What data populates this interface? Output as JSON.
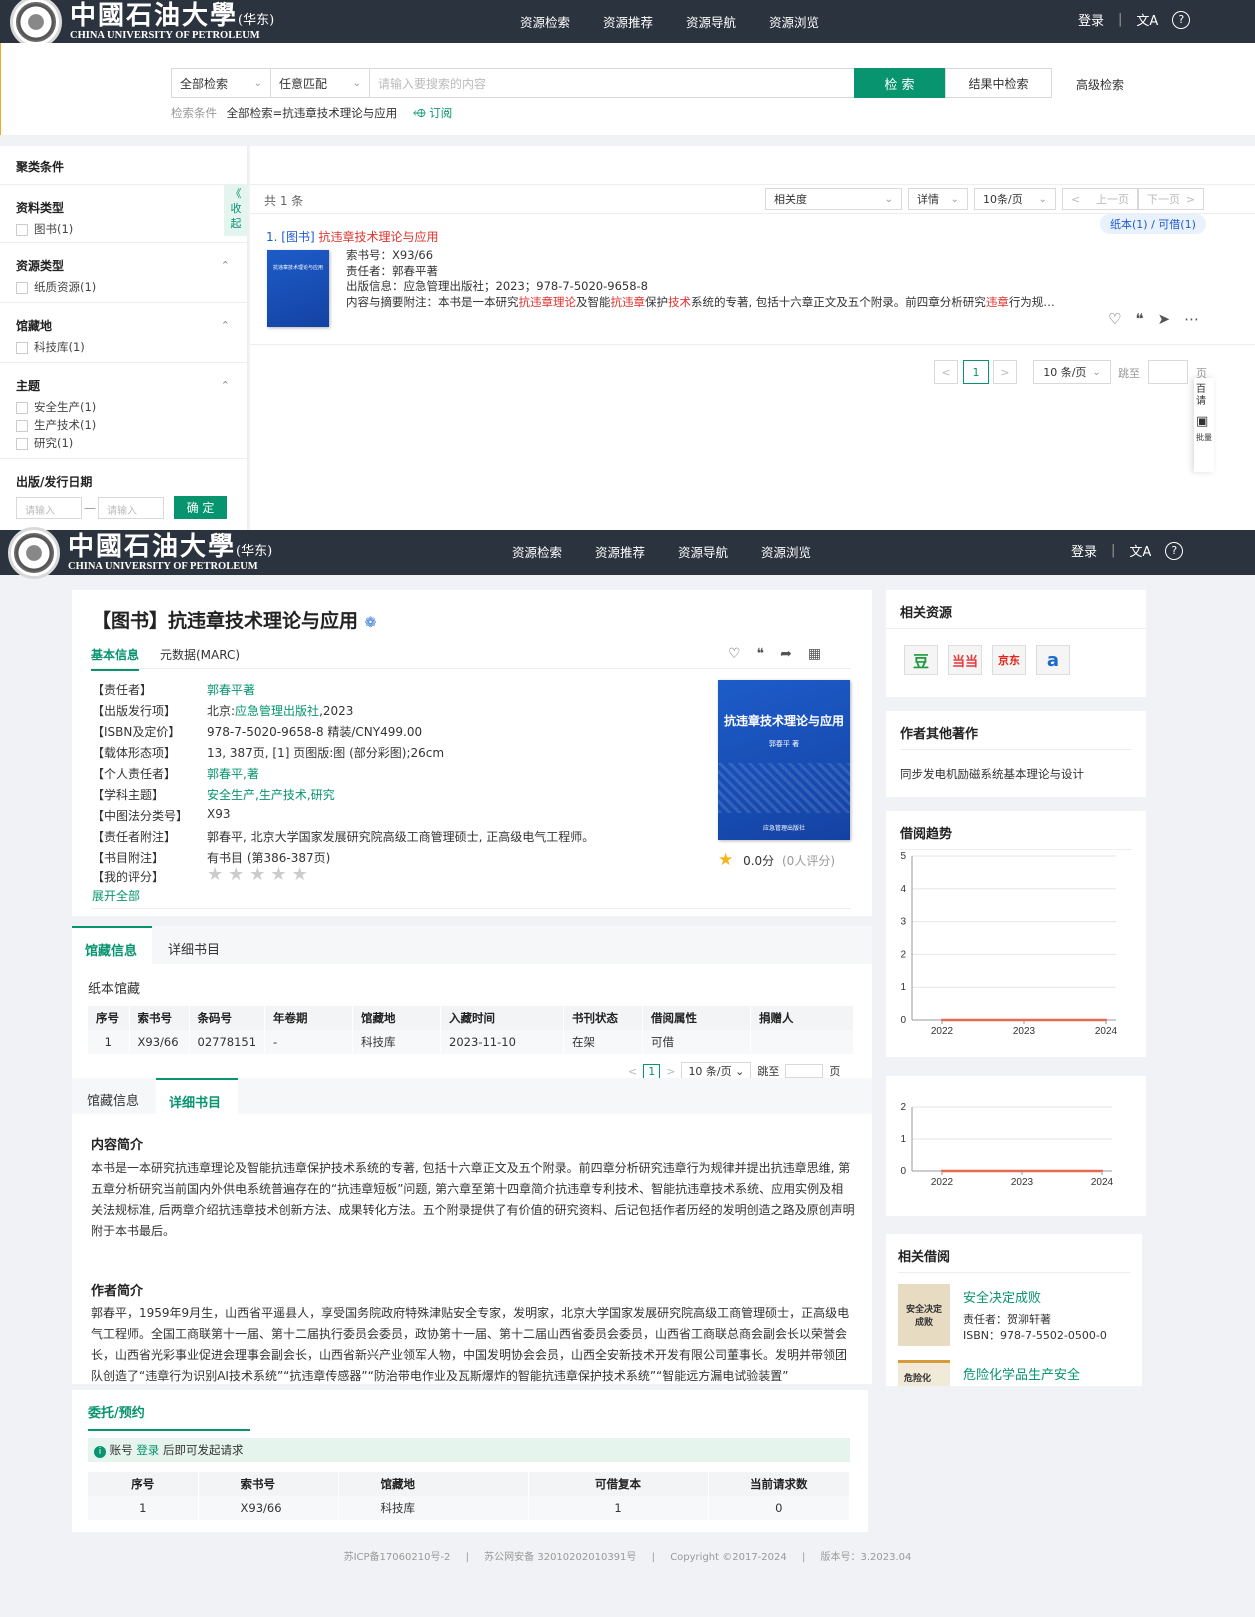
{
  "header": {
    "logo_cn": "中國石油大學",
    "logo_suffix": "(华东)",
    "logo_en": "CHINA UNIVERSITY OF PETROLEUM",
    "nav": [
      "资源检索",
      "资源推荐",
      "资源导航",
      "资源浏览"
    ],
    "login": "登录",
    "separator": "|",
    "translate_icon": "文A",
    "help_icon": "?"
  },
  "search": {
    "scope": "全部检索",
    "match": "任意匹配",
    "placeholder": "请输入要搜索的内容",
    "search_btn": "检 索",
    "in_results_btn": "结果中检索",
    "advanced": "高级检索",
    "cond_label": "检索条件",
    "cond_value": "全部检索=抗违章技术理论与应用",
    "subscribe": "订阅"
  },
  "facets": {
    "title": "聚类条件",
    "collapse": "《 收 起",
    "groups": [
      {
        "title": "资料类型",
        "items": [
          "图书(1)"
        ]
      },
      {
        "title": "资源类型",
        "items": [
          "纸质资源(1)"
        ]
      },
      {
        "title": "馆藏地",
        "items": [
          "科技库(1)"
        ]
      },
      {
        "title": "主题",
        "items": [
          "安全生产(1)",
          "生产技术(1)",
          "研究(1)"
        ]
      }
    ],
    "date_title": "出版/发行日期",
    "date_ph1": "请输入",
    "date_ph2": "请输入",
    "date_sep": "—",
    "confirm": "确 定"
  },
  "results": {
    "count": "共 1 条",
    "sort": "相关度",
    "view": "详情",
    "per_page": "10条/页",
    "prev": "上一页",
    "next": "下一页",
    "availability": "纸本(1) / 可借(1)",
    "item": {
      "index": "1.",
      "type": "[图书]",
      "title": "抗违章技术理论与应用",
      "callno": "索书号：X93/66",
      "author": "责任者：郭春平著",
      "pub": "出版信息：应急管理出版社；2023；978-7-5020-9658-8",
      "abstract_pre": "内容与摘要附注：本书是一本研究",
      "hl1": "抗违章理论",
      "mid1": "及智能",
      "hl2": "抗违章",
      "mid2": "保护",
      "hl3": "技术",
      "mid3": "系统的专著, 包括十六章正文及五个附录。前四章分析研究",
      "hl4": "违章",
      "tail": "行为规…"
    },
    "pager": {
      "prev": "<",
      "page": "1",
      "next": ">",
      "size": "10 条/页",
      "jump": "跳至",
      "page_unit": "页"
    }
  },
  "float_panel": {
    "t1": "百",
    "t2": "请",
    "t3": "批量"
  },
  "detail": {
    "title": "【图书】抗违章技术理论与应用",
    "tabs": [
      "基本信息",
      "元数据(MARC)"
    ],
    "fields": [
      {
        "k": "【责任者】",
        "v": "郭春平著",
        "link": true
      },
      {
        "k": "【出版发行项】",
        "v": "北京:应急管理出版社,2023",
        "link": false
      },
      {
        "k": "【ISBN及定价】",
        "v": "978-7-5020-9658-8 精装/CNY499.00",
        "link": false
      },
      {
        "k": "【载体形态项】",
        "v": "13, 387页, [1] 页图版:图 (部分彩图);26cm",
        "link": false
      },
      {
        "k": "【个人责任者】",
        "v": "郭春平,著",
        "link": true
      },
      {
        "k": "【学科主题】",
        "v": "安全生产,生产技术,研究",
        "link": true
      },
      {
        "k": "【中图法分类号】",
        "v": "X93",
        "link": false
      },
      {
        "k": "【责任者附注】",
        "v": "郭春平, 北京大学国家发展研究院高级工商管理硕士, 正高级电气工程师。",
        "link": false
      },
      {
        "k": "【书目附注】",
        "v": "有书目 (第386-387页)",
        "link": false
      },
      {
        "k": "【我的评分】",
        "v": "",
        "link": false
      }
    ],
    "pub_prefix": "北京:",
    "pub_link": "应急管理出版社",
    "pub_suffix": ",2023",
    "expand": "展开全部",
    "score": "0.0分",
    "score_count": "(0人评分)",
    "cover_title": "抗违章技术理论与应用",
    "cover_author": "郭春平 著",
    "cover_pub": "应急管理出版社"
  },
  "holdings": {
    "tabs": [
      "馆藏信息",
      "详细书目"
    ],
    "sub": "纸本馆藏",
    "columns": [
      "序号",
      "索书号",
      "条码号",
      "年卷期",
      "馆藏地",
      "入藏时间",
      "书刊状态",
      "借阅属性",
      "捐赠人"
    ],
    "rows": [
      [
        "1",
        "X93/66",
        "02778151",
        "-",
        "科技库",
        "2023-11-10",
        "在架",
        "可借",
        ""
      ]
    ],
    "pager": {
      "page": "1",
      "size": "10 条/页",
      "jump": "跳至",
      "unit": "页"
    }
  },
  "bib": {
    "tabs": [
      "馆藏信息",
      "详细书目"
    ],
    "intro_title": "内容简介",
    "intro": "本书是一本研究抗违章理论及智能抗违章保护技术系统的专著, 包括十六章正文及五个附录。前四章分析研究违章行为规律并提出抗违章思维, 第五章分析研究当前国内外供电系统普遍存在的“抗违章短板”问题, 第六章至第十四章简介抗违章专利技术、智能抗违章技术系统、应用实例及相关法规标准, 后两章介绍抗违章技术创新方法、成果转化方法。五个附录提供了有价值的研究资料、后记包括作者历经的发明创造之路及原创声明附于本书最后。",
    "author_title": "作者简介",
    "author": "郭春平，1959年9月生，山西省平遥县人，享受国务院政府特殊津贴安全专家，发明家，北京大学国家发展研究院高级工商管理硕士，正高级电气工程师。全国工商联第十一届、第十二届执行委员会委员，政协第十一届、第十二届山西省委员会委员，山西省工商联总商会副会长以荣誉会长，山西省光彩事业促进会理事会副会长，山西省新兴产业领军人物，中国发明协会会员，山西全安新技术开发有限公司董事长。发明并带领团队创造了“违章行为识别AI技术系统”“抗违章传感器”“防治带电作业及瓦斯爆炸的智能抗违章保护技术系统”“智能远方漏电试验装置”"
  },
  "request": {
    "title": "委托/预约",
    "notice_pre": "账号",
    "notice_link": "登录",
    "notice_post": "后即可发起请求",
    "columns": [
      "序号",
      "索书号",
      "馆藏地",
      "可借复本",
      "当前请求数"
    ],
    "rows": [
      [
        "1",
        "X93/66",
        "科技库",
        "1",
        "0"
      ]
    ]
  },
  "side": {
    "related_title": "相关资源",
    "stores": [
      "豆",
      "当当",
      "京东",
      "a"
    ],
    "author_title": "作者其他著作",
    "author_work": "同步发电机励磁系统基本理论与设计",
    "trend_title": "借阅趋势",
    "related_borrow_title": "相关借阅",
    "borrow": [
      {
        "title": "安全决定成败",
        "author": "责任者：贺泖轩著",
        "isbn": "ISBN：978-7-5502-0500-0",
        "cover": "安全决定成败"
      },
      {
        "title": "危险化学品生产安全",
        "cover": "危险化"
      }
    ]
  },
  "chart_data": [
    {
      "type": "line",
      "title": "借阅趋势",
      "x": [
        "2022",
        "2023",
        "2024"
      ],
      "values": [
        0,
        0,
        0
      ],
      "ylim": [
        0,
        5
      ],
      "yticks": [
        0,
        1,
        2,
        3,
        4,
        5
      ],
      "grid": true,
      "color": "#e86a4e"
    },
    {
      "type": "line",
      "x": [
        "2022",
        "2023",
        "2024"
      ],
      "values": [
        0,
        0,
        0
      ],
      "yticks": [
        0,
        1,
        2
      ],
      "grid": true,
      "color": "#e86a4e"
    }
  ],
  "footer": {
    "icp": "苏ICP备17060210号-2",
    "sep": "|",
    "police": "苏公网安备 32010202010391号",
    "copy": "Copyright ©2017-2024",
    "version": "版本号：3.2023.04"
  },
  "colors": {
    "accent": "#07946f",
    "header": "#2b333e",
    "highlight": "#e0322d",
    "link": "#1f5bd1"
  }
}
